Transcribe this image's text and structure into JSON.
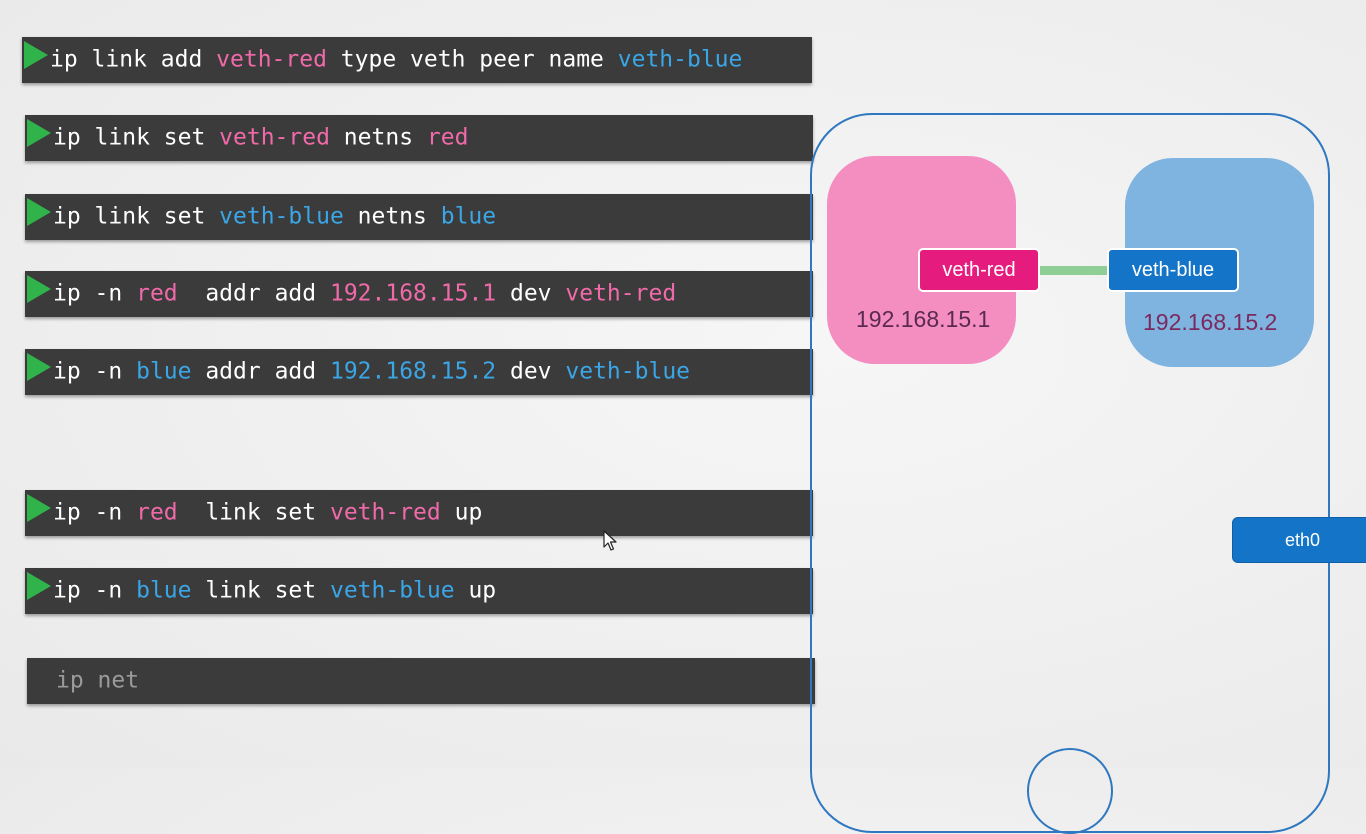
{
  "commands": [
    {
      "prompt": true,
      "tokens": [
        {
          "text": "ip link add ",
          "color": "white"
        },
        {
          "text": "veth-red",
          "color": "pink"
        },
        {
          "text": " type veth peer name ",
          "color": "white"
        },
        {
          "text": "veth-blue",
          "color": "blue"
        }
      ]
    },
    {
      "prompt": true,
      "tokens": [
        {
          "text": "ip link set ",
          "color": "white"
        },
        {
          "text": "veth-red",
          "color": "pink"
        },
        {
          "text": " netns ",
          "color": "white"
        },
        {
          "text": "red",
          "color": "pink"
        }
      ]
    },
    {
      "prompt": true,
      "tokens": [
        {
          "text": "ip link set ",
          "color": "white"
        },
        {
          "text": "veth-blue",
          "color": "blue"
        },
        {
          "text": " netns ",
          "color": "white"
        },
        {
          "text": "blue",
          "color": "blue"
        }
      ]
    },
    {
      "prompt": true,
      "tokens": [
        {
          "text": "ip -n ",
          "color": "white"
        },
        {
          "text": "red",
          "color": "pink"
        },
        {
          "text": "  addr add ",
          "color": "white"
        },
        {
          "text": "192.168.15.1",
          "color": "pink"
        },
        {
          "text": " dev ",
          "color": "white"
        },
        {
          "text": "veth-red",
          "color": "pink"
        }
      ]
    },
    {
      "prompt": true,
      "tokens": [
        {
          "text": "ip -n ",
          "color": "white"
        },
        {
          "text": "blue",
          "color": "blue"
        },
        {
          "text": " addr add ",
          "color": "white"
        },
        {
          "text": "192.168.15.2",
          "color": "blue"
        },
        {
          "text": " dev ",
          "color": "white"
        },
        {
          "text": "veth-blue",
          "color": "blue"
        }
      ]
    },
    {
      "prompt": true,
      "tokens": [
        {
          "text": "ip -n ",
          "color": "white"
        },
        {
          "text": "red",
          "color": "pink"
        },
        {
          "text": "  link set ",
          "color": "white"
        },
        {
          "text": "veth-red",
          "color": "pink"
        },
        {
          "text": " up",
          "color": "white"
        }
      ]
    },
    {
      "prompt": true,
      "tokens": [
        {
          "text": "ip -n ",
          "color": "white"
        },
        {
          "text": "blue",
          "color": "blue"
        },
        {
          "text": " link set ",
          "color": "white"
        },
        {
          "text": "veth-blue",
          "color": "blue"
        },
        {
          "text": " up",
          "color": "white"
        }
      ]
    },
    {
      "prompt": false,
      "dim": true,
      "tokens": [
        {
          "text": "ip net",
          "color": "gray"
        }
      ]
    }
  ],
  "colors": {
    "white": "#ffffff",
    "pink": "#f06aaa",
    "blue": "#3ba6e6",
    "gray": "#9a9a9a",
    "prompt_arrow": "#2fb34a",
    "command_bg": "#3b3b3b",
    "namespace_red": "#f48dc0",
    "namespace_blue": "#7fb3e0",
    "iface_red": "#e51b7e",
    "iface_blue": "#1474c7",
    "link": "#8fcf95",
    "host_border": "#2f78c0"
  },
  "diagram": {
    "red_namespace": {
      "interface": "veth-red",
      "ip": "192.168.15.1"
    },
    "blue_namespace": {
      "interface": "veth-blue",
      "ip": "192.168.15.2"
    },
    "host_interface": "eth0"
  }
}
